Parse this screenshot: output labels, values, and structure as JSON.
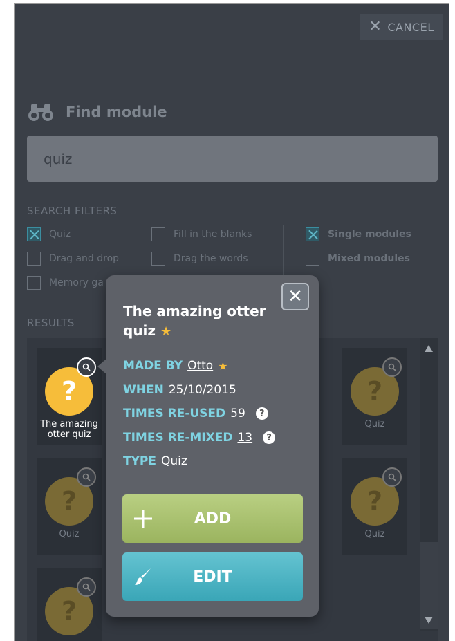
{
  "header": {
    "cancel_label": "CANCEL"
  },
  "find": {
    "title": "Find module",
    "query": "quiz"
  },
  "filters": {
    "label": "SEARCH FILTERS",
    "items": [
      {
        "label": "Quiz",
        "checked": true
      },
      {
        "label": "Fill in the blanks",
        "checked": false
      },
      {
        "label": "Single modules",
        "checked": true
      },
      {
        "label": "Drag and drop",
        "checked": false
      },
      {
        "label": "Drag the words",
        "checked": false
      },
      {
        "label": "Mixed modules",
        "checked": false
      },
      {
        "label": "Memory ga",
        "checked": false
      }
    ]
  },
  "results": {
    "label": "RESULTS",
    "cards": [
      {
        "label": "The amazing otter quiz",
        "active": true
      },
      {
        "label": "Quiz"
      },
      {
        "label": "Quiz"
      },
      {
        "label": "Quiz"
      }
    ]
  },
  "popup": {
    "title": "The amazing otter quiz",
    "made_by_key": "MADE BY",
    "made_by_val": "Otto",
    "when_key": "WHEN",
    "when_val": "25/10/2015",
    "reused_key": "TIMES RE-USED",
    "reused_val": "59",
    "remixed_key": "TIMES RE-MIXED",
    "remixed_val": "13",
    "type_key": "TYPE",
    "type_val": "Quiz",
    "add_label": "ADD",
    "edit_label": "EDIT"
  },
  "colors": {
    "accent": "#7fd3e2",
    "star": "#f6bd3a",
    "add": "#a8c16c",
    "edit": "#48b2c2"
  }
}
